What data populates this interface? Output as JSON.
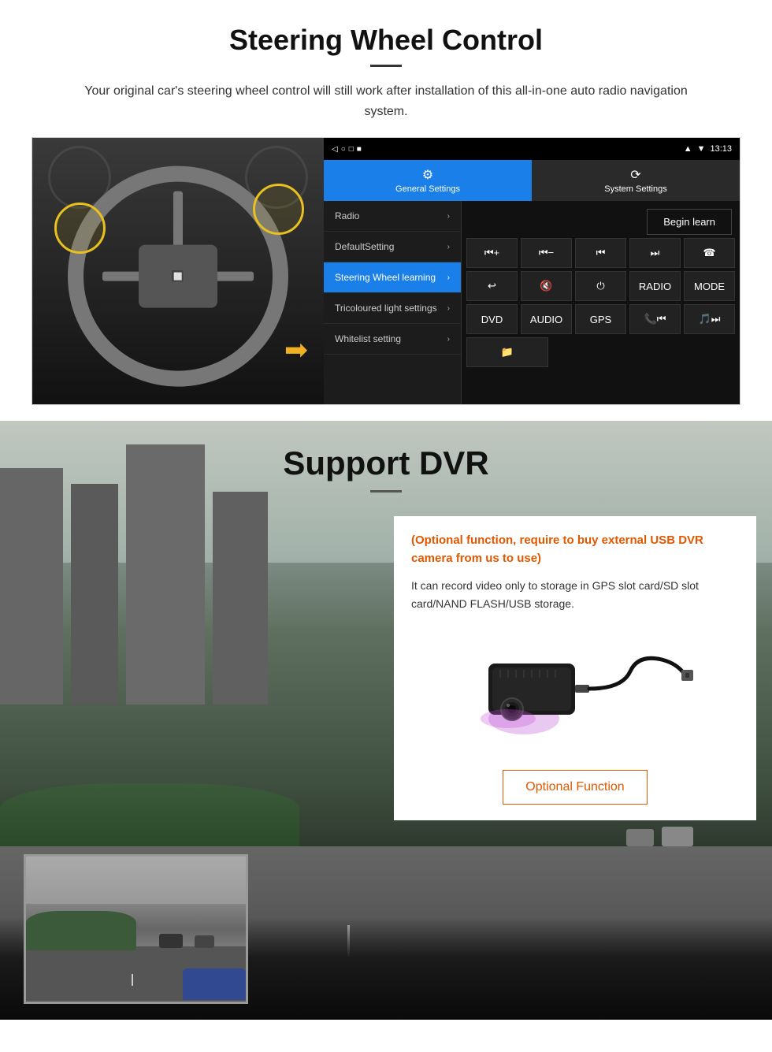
{
  "page": {
    "steering_section": {
      "title": "Steering Wheel Control",
      "subtitle": "Your original car's steering wheel control will still work after installation of this all-in-one auto radio navigation system.",
      "divider": "—",
      "statusbar": {
        "time": "13:13",
        "icons": "▲ ▼ ■"
      },
      "tabs": {
        "general": {
          "icon": "⚙",
          "label": "General Settings"
        },
        "system": {
          "icon": "🔄",
          "label": "System Settings"
        }
      },
      "menu_items": [
        {
          "label": "Radio",
          "active": false
        },
        {
          "label": "DefaultSetting",
          "active": false
        },
        {
          "label": "Steering Wheel learning",
          "active": true
        },
        {
          "label": "Tricoloured light settings",
          "active": false
        },
        {
          "label": "Whitelist setting",
          "active": false
        }
      ],
      "begin_learn": "Begin learn",
      "control_buttons": {
        "row1": [
          "⏮+",
          "⏮-",
          "⏮",
          "⏭",
          "☎"
        ],
        "row2": [
          "↩",
          "🔇",
          "⏻",
          "RADIO",
          "MODE"
        ],
        "row3": [
          "DVD",
          "AUDIO",
          "GPS",
          "📞⏮",
          "🎵⏭"
        ],
        "row4": [
          "📁"
        ]
      }
    },
    "dvr_section": {
      "title": "Support DVR",
      "optional_text": "(Optional function, require to buy external USB DVR camera from us to use)",
      "description": "It can record video only to storage in GPS slot card/SD slot card/NAND FLASH/USB storage.",
      "optional_function_btn": "Optional Function"
    }
  }
}
